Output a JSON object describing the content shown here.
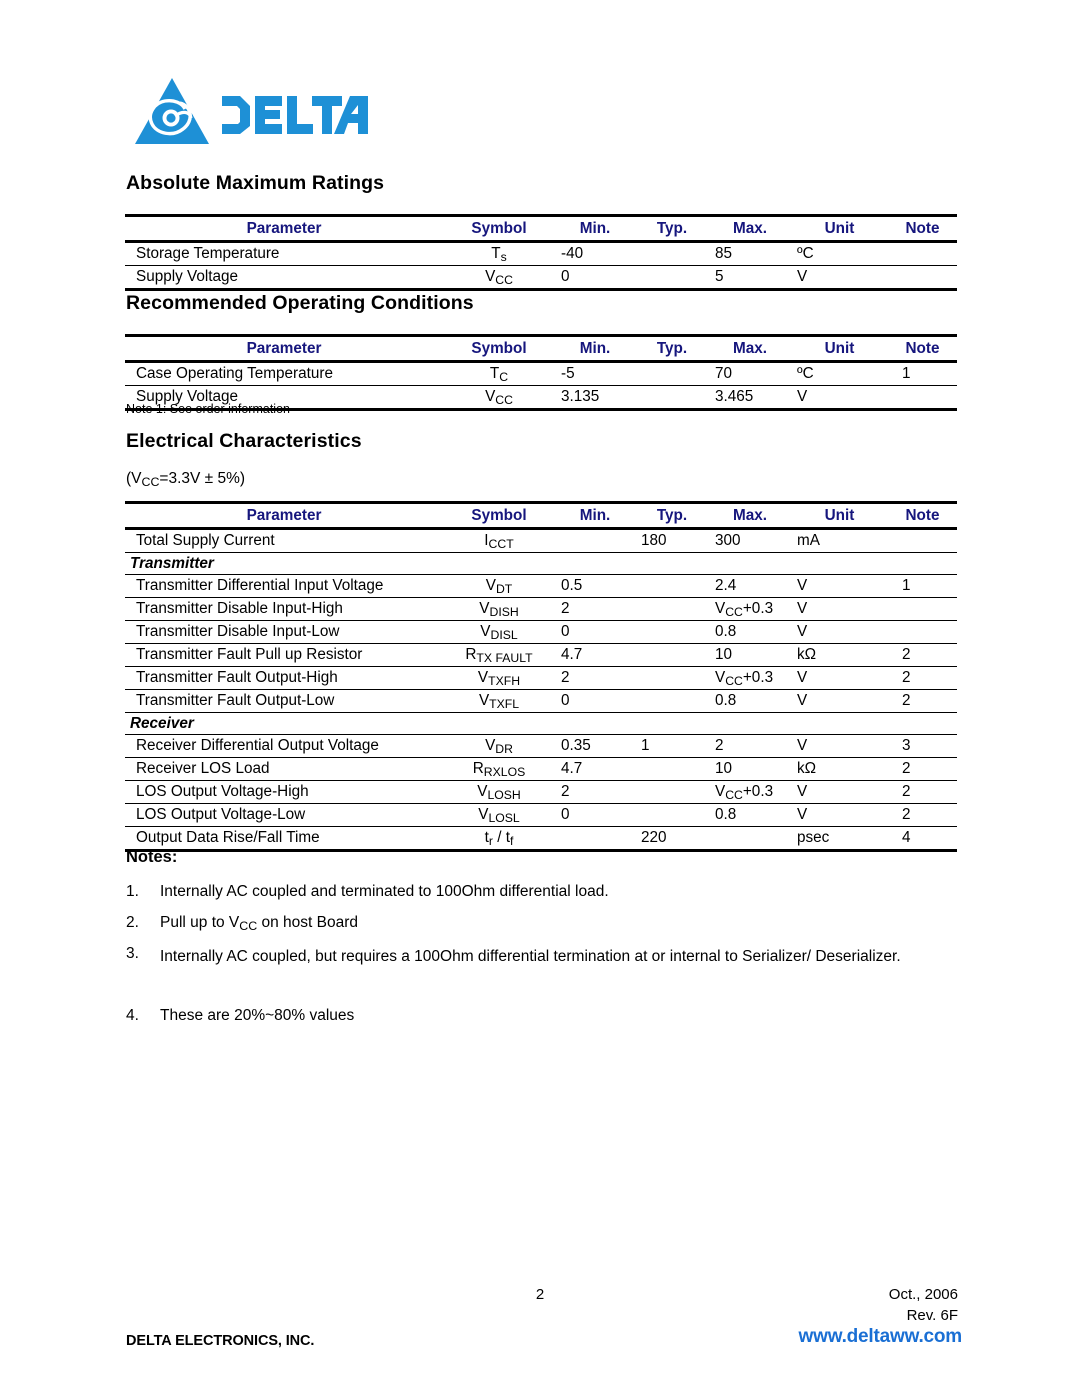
{
  "brand": {
    "logo_text": "DELTA",
    "logo_color": "#1e90d6",
    "logo_mark_name": "delta-triangle-swirl-logo"
  },
  "header_color": "#16167d",
  "sections": [
    {
      "id": "absolute-maximum-ratings",
      "title": "Absolute Maximum Ratings",
      "columns": [
        "Parameter",
        "Symbol",
        "Min.",
        "Typ.",
        "Max.",
        "Unit",
        "Note"
      ],
      "rows": [
        {
          "parameter": "Storage Temperature",
          "symbol_base": "T",
          "symbol_sub": "s",
          "min": "-40",
          "typ": "",
          "max": "85",
          "unit": "ºC",
          "note": ""
        },
        {
          "parameter": "Supply Voltage",
          "symbol_base": "V",
          "symbol_sub": "CC",
          "min": "0",
          "typ": "",
          "max": "5",
          "unit": "V",
          "note": ""
        }
      ]
    },
    {
      "id": "recommended-operating-conditions",
      "title": "Recommended Operating Conditions",
      "columns": [
        "Parameter",
        "Symbol",
        "Min.",
        "Typ.",
        "Max.",
        "Unit",
        "Note"
      ],
      "rows": [
        {
          "parameter": "Case Operating Temperature",
          "symbol_base": "T",
          "symbol_sub": "C",
          "min": "-5",
          "typ": "",
          "max": "70",
          "unit": "ºC",
          "note": "1"
        },
        {
          "parameter": "Supply Voltage",
          "symbol_base": "V",
          "symbol_sub": "CC",
          "min": "3.135",
          "typ": "",
          "max": "3.465",
          "unit": "V",
          "note": ""
        }
      ],
      "footnote": "Note 1: See order information"
    },
    {
      "id": "electrical-characteristics",
      "title": "Electrical Characteristics",
      "condition_prefix": "(V",
      "condition_sub": "CC",
      "condition_suffix": "=3.3V ± 5%)",
      "columns": [
        "Parameter",
        "Symbol",
        "Min.",
        "Typ.",
        "Max.",
        "Unit",
        "Note"
      ],
      "rows": [
        {
          "type": "data",
          "parameter": "Total Supply Current",
          "symbol_base": "I",
          "symbol_sub": "CCT",
          "min": "",
          "typ": "180",
          "max": "300",
          "unit": "mA",
          "note": ""
        },
        {
          "type": "group",
          "label": "Transmitter"
        },
        {
          "type": "data",
          "parameter": "Transmitter Differential Input Voltage",
          "symbol_base": "V",
          "symbol_sub": "DT",
          "min": "0.5",
          "typ": "",
          "max": "2.4",
          "unit": "V",
          "note": "1"
        },
        {
          "type": "data",
          "parameter": "Transmitter Disable Input-High",
          "symbol_base": "V",
          "symbol_sub": "DISH",
          "min": "2",
          "typ": "",
          "max_base": "V",
          "max_sub": "CC",
          "max_tail": "+0.3",
          "unit": "V",
          "note": ""
        },
        {
          "type": "data",
          "parameter": "Transmitter Disable Input-Low",
          "symbol_base": "V",
          "symbol_sub": "DISL",
          "min": "0",
          "typ": "",
          "max": "0.8",
          "unit": "V",
          "note": ""
        },
        {
          "type": "data",
          "parameter": "Transmitter Fault Pull up Resistor",
          "symbol_base": "R",
          "symbol_sub": "TX FAULT",
          "min": "4.7",
          "typ": "",
          "max": "10",
          "unit": "kΩ",
          "note": "2"
        },
        {
          "type": "data",
          "parameter": "Transmitter Fault Output-High",
          "symbol_base": "V",
          "symbol_sub": "TXFH",
          "min": "2",
          "typ": "",
          "max_base": "V",
          "max_sub": "CC",
          "max_tail": "+0.3",
          "unit": "V",
          "note": "2"
        },
        {
          "type": "data",
          "parameter": "Transmitter Fault Output-Low",
          "symbol_base": "V",
          "symbol_sub": "TXFL",
          "min": "0",
          "typ": "",
          "max": "0.8",
          "unit": "V",
          "note": "2"
        },
        {
          "type": "group",
          "label": "Receiver"
        },
        {
          "type": "data",
          "parameter": "Receiver Differential Output Voltage",
          "symbol_base": "V",
          "symbol_sub": "DR",
          "min": "0.35",
          "typ": "1",
          "max": "2",
          "unit": "V",
          "note": "3"
        },
        {
          "type": "data",
          "parameter": "Receiver LOS Load",
          "symbol_base": "R",
          "symbol_sub": "RXLOS",
          "min": "4.7",
          "typ": "",
          "max": "10",
          "unit": "kΩ",
          "note": "2"
        },
        {
          "type": "data",
          "parameter": "LOS Output Voltage-High",
          "symbol_base": "V",
          "symbol_sub": "LOSH",
          "min": "2",
          "typ": "",
          "max_base": "V",
          "max_sub": "CC",
          "max_tail": "+0.3",
          "unit": "V",
          "note": "2"
        },
        {
          "type": "data",
          "parameter": "LOS Output Voltage-Low",
          "symbol_base": "V",
          "symbol_sub": "LOSL",
          "min": "0",
          "typ": "",
          "max": "0.8",
          "unit": "V",
          "note": "2"
        },
        {
          "type": "data",
          "parameter": "Output Data Rise/Fall Time",
          "symbol_special": "t_r / t_f",
          "min": "",
          "typ": "220",
          "max": "",
          "unit": "psec",
          "note": "4"
        }
      ]
    }
  ],
  "notes": {
    "title": "Notes:",
    "items": [
      {
        "num": "1.",
        "text": "Internally AC coupled and terminated to 100Ohm differential load."
      },
      {
        "num": "2.",
        "text_prefix": "Pull up to V",
        "text_sub": "CC",
        "text_suffix": " on host Board"
      },
      {
        "num": "3.",
        "text": "Internally AC coupled, but requires a 100Ohm differential termination at or internal to Serializer/ Deserializer."
      },
      {
        "num": "4.",
        "text": "These are 20%~80% values"
      }
    ]
  },
  "footer": {
    "page_number": "2",
    "date": "Oct.,  2006",
    "revision": "Rev. 6F",
    "company": "DELTA ELECTRONICS, INC.",
    "url": "www.deltaww.com",
    "url_color": "#1a6fd4"
  }
}
